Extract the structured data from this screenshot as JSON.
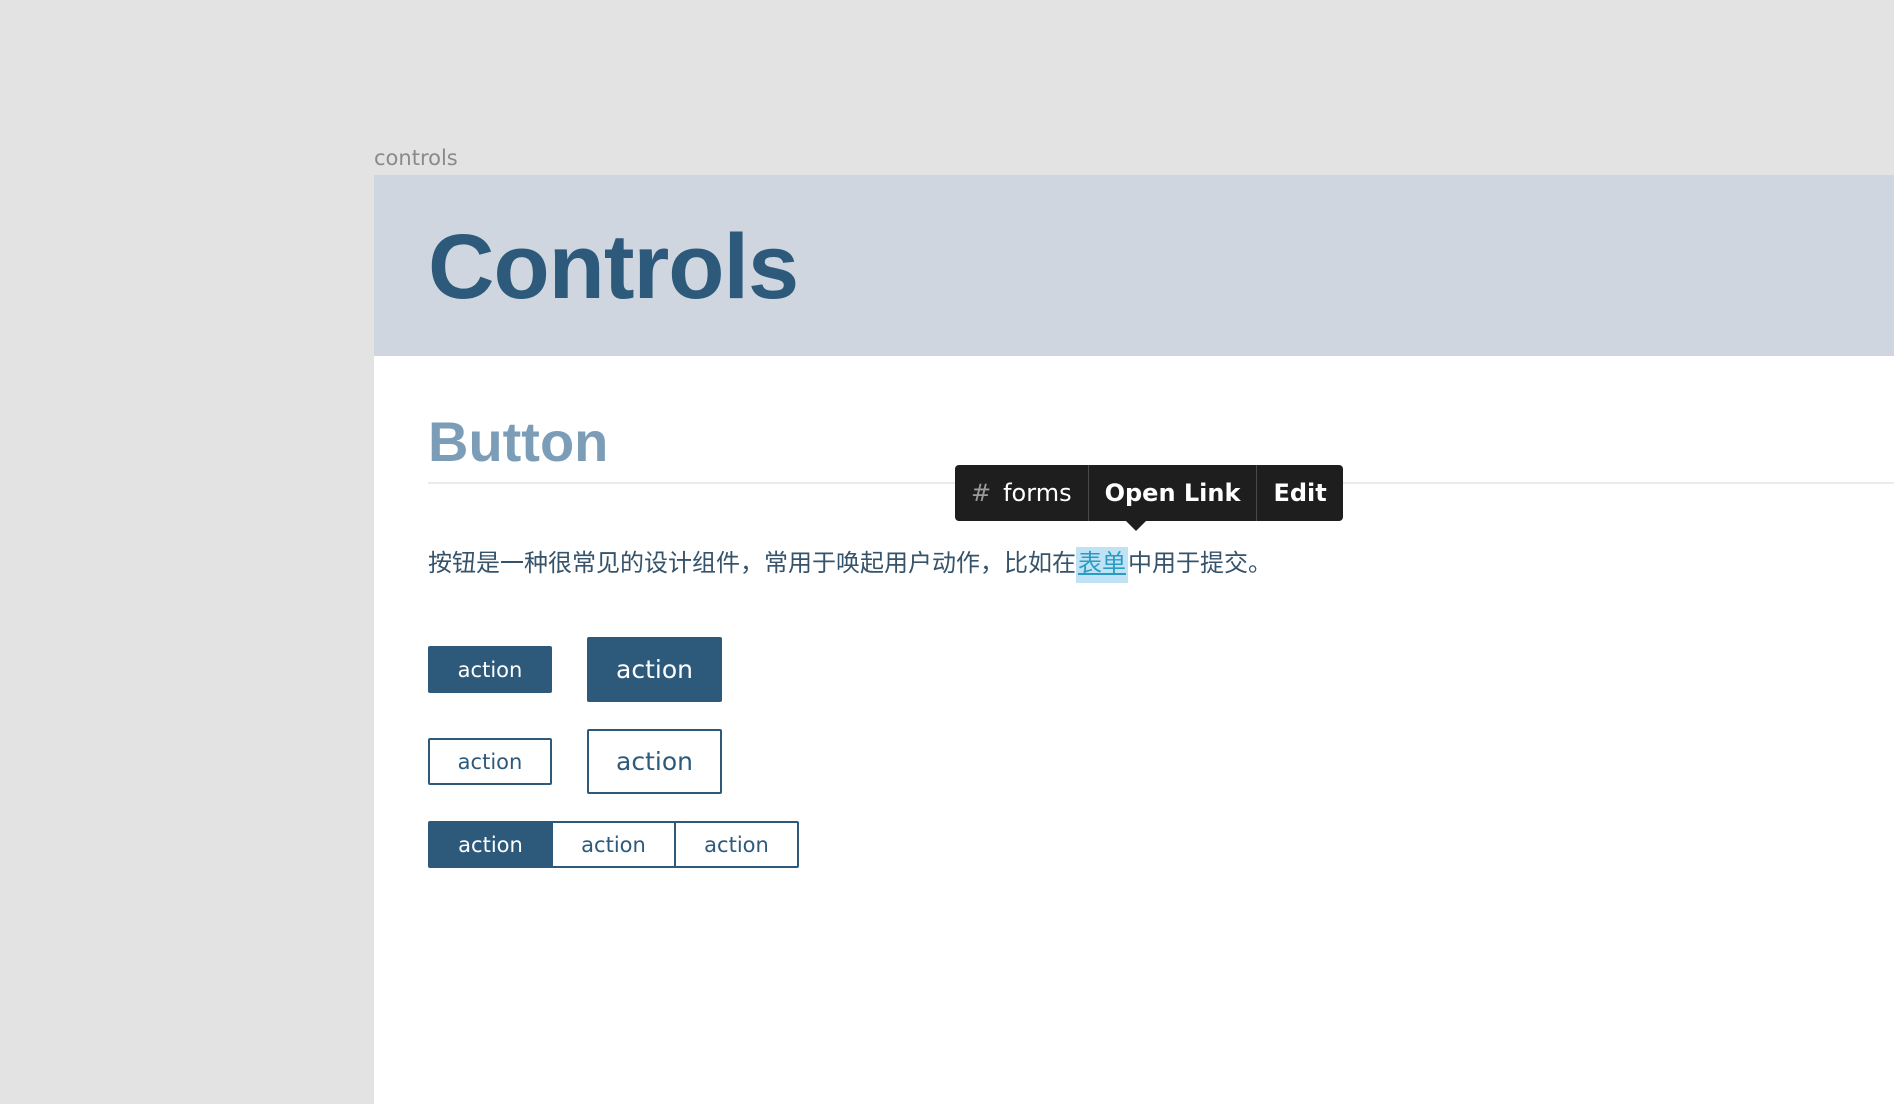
{
  "frame": {
    "label": "controls"
  },
  "hero": {
    "title": "Controls"
  },
  "section": {
    "title": "Button",
    "paragraph_before": "按钮是一种很常见的设计组件，常用于唤起用户动作，比如在",
    "link_text": "表单",
    "paragraph_after": "中用于提交。"
  },
  "tooltip": {
    "tag_icon": "hash-icon",
    "tag_label": "forms",
    "open_link_label": "Open Link",
    "edit_label": "Edit"
  },
  "buttons": {
    "filled_small": "action",
    "filled_large": "action",
    "outline_small": "action",
    "outline_large": "action"
  },
  "button_group": {
    "items": [
      {
        "label": "action",
        "active": true
      },
      {
        "label": "action",
        "active": false
      },
      {
        "label": "action",
        "active": false
      }
    ]
  },
  "colors": {
    "primary": "#2d5a7b",
    "hero_bg": "#cfd6df",
    "section_title": "#7b9db7",
    "link": "#2a9cc4",
    "link_highlight": "#bfe3f5",
    "tooltip_bg": "#1e1e1e",
    "canvas_bg": "#e3e3e3"
  }
}
